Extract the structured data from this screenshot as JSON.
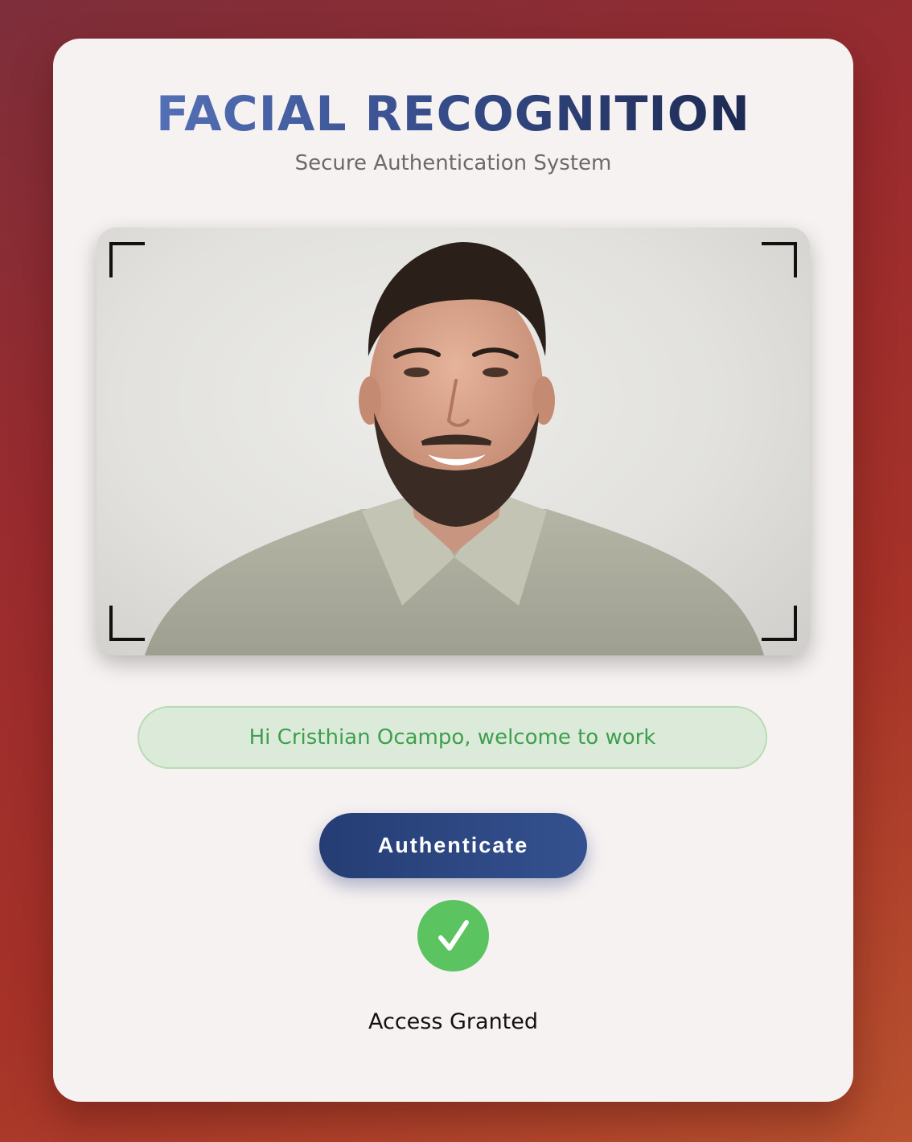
{
  "header": {
    "title": "FACIAL RECOGNITION",
    "subtitle": "Secure Authentication System"
  },
  "camera": {
    "feed_description": "camera-feed",
    "frame_corners": [
      "top-left",
      "top-right",
      "bottom-left",
      "bottom-right"
    ]
  },
  "welcome": {
    "message": "Hi Cristhian Ocampo, welcome to work"
  },
  "actions": {
    "authenticate_label": "Authenticate"
  },
  "status": {
    "icon": "checkmark-icon",
    "text": "Access Granted"
  },
  "colors": {
    "accent": "#2d4682",
    "success": "#5cc361",
    "success_text": "#3e9f4e",
    "success_bg": "#dcebd9"
  }
}
